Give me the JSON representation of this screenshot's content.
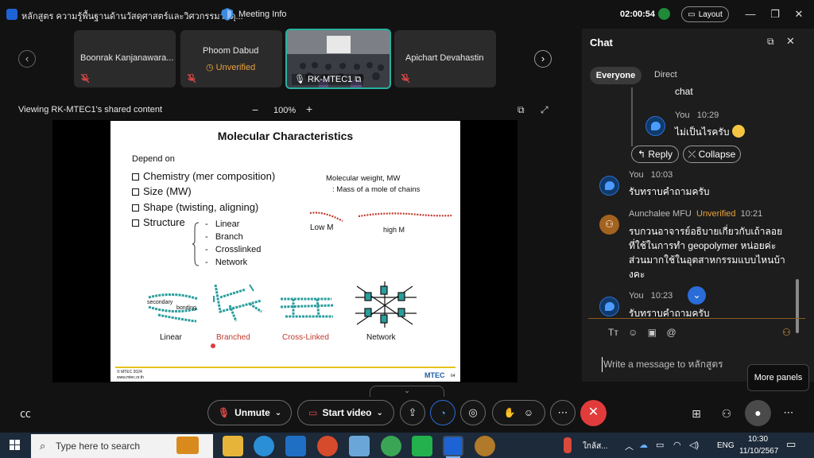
{
  "window": {
    "title": "หลักสูตร ความรู้พื้นฐานด้านวัสดุศาสตร์และวิศวกรรมวัสดุ...",
    "meeting_info": "Meeting Info",
    "clock": "02:00:54",
    "layout_label": "Layout"
  },
  "participants": [
    {
      "name": "Boonrak Kanjanawara...",
      "muted": true
    },
    {
      "name": "Phoom Dabud",
      "status": "Unverified",
      "muted": true
    },
    {
      "name": "RK-MTEC1",
      "video": true
    },
    {
      "name": "Apichart Devahastin",
      "muted": true
    }
  ],
  "share": {
    "viewing_label": "Viewing RK-MTEC1's shared content",
    "zoom": "100%"
  },
  "slide": {
    "title": "Molecular Characteristics",
    "depend_on": "Depend on",
    "items": [
      "Chemistry (mer composition)",
      "Size (MW)",
      "Shape (twisting, aligning)",
      "Structure"
    ],
    "structure_types": [
      "Linear",
      "Branch",
      "Crosslinked",
      "Network"
    ],
    "mw_label": "Molecular weight, MW",
    "mw_def": ": Mass of a mole of chains",
    "low_m": "Low M",
    "high_m": "high M",
    "diagram_secondary": "secondary",
    "diagram_bonding": "bonding",
    "fig_labels": [
      "Linear",
      "Branched",
      "Cross-Linked",
      "Network"
    ],
    "footer_left_1": "© MTEC 2024",
    "footer_left_2": "www.mtec.or.th",
    "footer_logo": "MTEC",
    "page_number": "64"
  },
  "chat": {
    "title": "Chat",
    "tabs": {
      "everyone": "Everyone",
      "direct": "Direct"
    },
    "messages": [
      {
        "text": "chat"
      },
      {
        "sender": "You",
        "time": "10:29",
        "text": "ไม่เป็นไรครับ"
      },
      {
        "sender": "You",
        "time": "10:03",
        "text": "รับทราบคำถามครับ"
      },
      {
        "sender": "Aunchalee MFU",
        "status": "Unverified",
        "time": "10:21",
        "lines": [
          "รบกวนอาจารย์อธิบายเกี่ยวกับเถ้าลอย",
          "ที่ใช้ในการทำ geopolymer หน่อยค่ะ",
          "ส่วนมากใช้ในอุตสาหกรรมแบบไหนบ้า",
          "งคะ"
        ]
      },
      {
        "sender": "You",
        "time": "10:23",
        "text": "รับทราบคำถามครับ"
      }
    ],
    "reply_label": "Reply",
    "collapse_label": "Collapse",
    "compose_placeholder": "Write a message to หลักสูตร"
  },
  "controls": {
    "unmute": "Unmute",
    "start_video": "Start video",
    "more_panels_tooltip": "More panels"
  },
  "taskbar": {
    "search_placeholder": "Type here to search",
    "weather_text": "ใกล้ส...",
    "language": "ENG",
    "time": "10:30",
    "date": "11/10/2567"
  },
  "colors": {
    "accent_teal": "#29b0a0",
    "unverified_orange": "#e8a13c",
    "end_call_red": "#e23b3b",
    "chat_blue": "#2a6dd8"
  }
}
